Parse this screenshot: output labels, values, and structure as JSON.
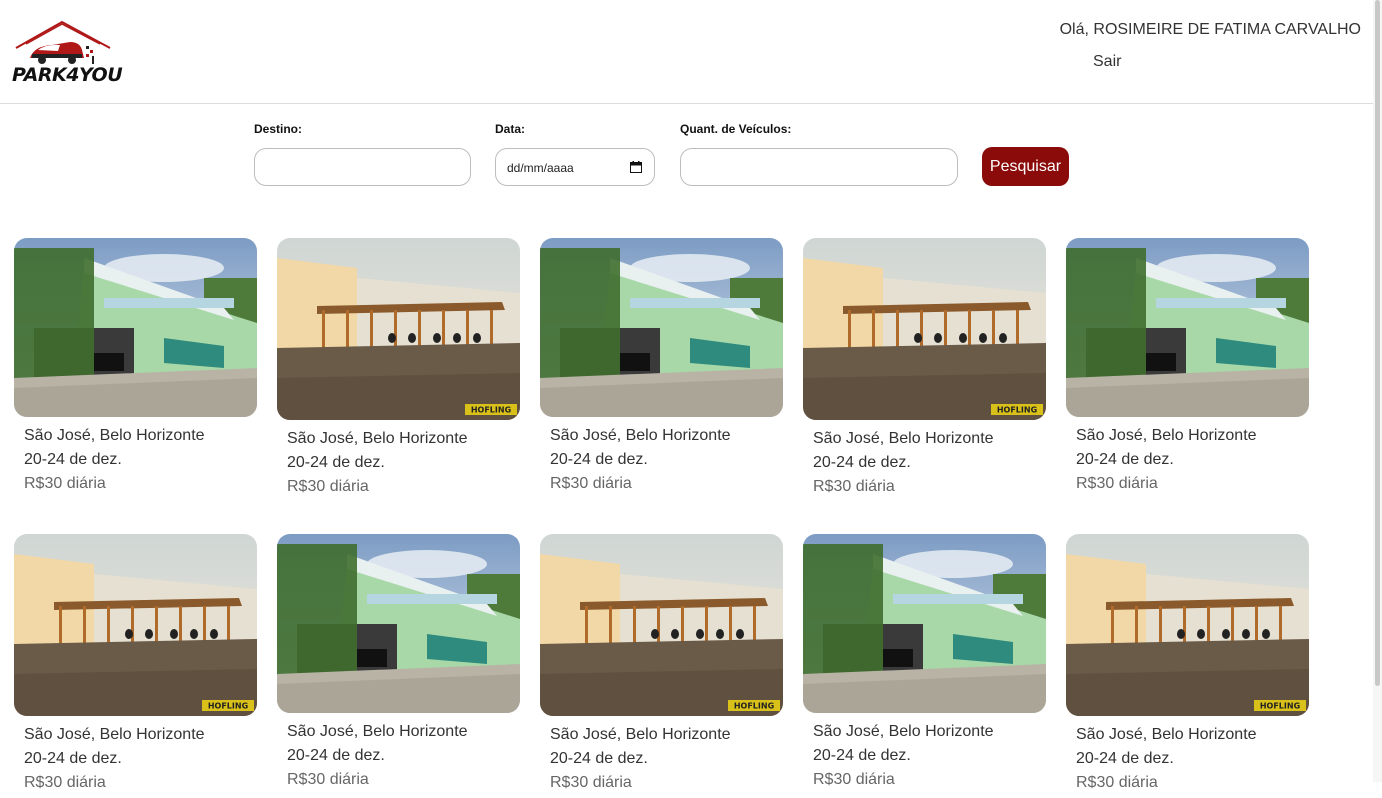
{
  "brand": {
    "name": "PARK4YOU",
    "accent": "#8b0a0a"
  },
  "user": {
    "greeting": "Olá, ROSIMEIRE DE FATIMA CARVALHO",
    "logout": "Sair"
  },
  "search": {
    "destination_label": "Destino:",
    "destination_value": "",
    "date_label": "Data:",
    "date_placeholder": "dd/mm/aaaa",
    "vehicles_label": "Quant. de Veículos:",
    "vehicles_value": "",
    "button": "Pesquisar"
  },
  "listings": [
    {
      "photo": "green-house-garage",
      "location": "São José, Belo Horizonte",
      "dates": "20-24 de dez.",
      "price": "R$30 diária"
    },
    {
      "photo": "open-carport-lot",
      "location": "São José, Belo Horizonte",
      "dates": "20-24 de dez.",
      "price": "R$30 diária"
    },
    {
      "photo": "green-house-garage",
      "location": "São José, Belo Horizonte",
      "dates": "20-24 de dez.",
      "price": "R$30 diária"
    },
    {
      "photo": "open-carport-lot",
      "location": "São José, Belo Horizonte",
      "dates": "20-24 de dez.",
      "price": "R$30 diária"
    },
    {
      "photo": "green-house-garage",
      "location": "São José, Belo Horizonte",
      "dates": "20-24 de dez.",
      "price": "R$30 diária"
    },
    {
      "photo": "open-carport-lot",
      "location": "São José, Belo Horizonte",
      "dates": "20-24 de dez.",
      "price": "R$30 diária"
    },
    {
      "photo": "green-house-garage",
      "location": "São José, Belo Horizonte",
      "dates": "20-24 de dez.",
      "price": "R$30 diária"
    },
    {
      "photo": "open-carport-lot",
      "location": "São José, Belo Horizonte",
      "dates": "20-24 de dez.",
      "price": "R$30 diária"
    },
    {
      "photo": "green-house-garage",
      "location": "São José, Belo Horizonte",
      "dates": "20-24 de dez.",
      "price": "R$30 diária"
    },
    {
      "photo": "open-carport-lot",
      "location": "São José, Belo Horizonte",
      "dates": "20-24 de dez.",
      "price": "R$30 diária"
    }
  ],
  "photo_watermark": "HOFLING"
}
